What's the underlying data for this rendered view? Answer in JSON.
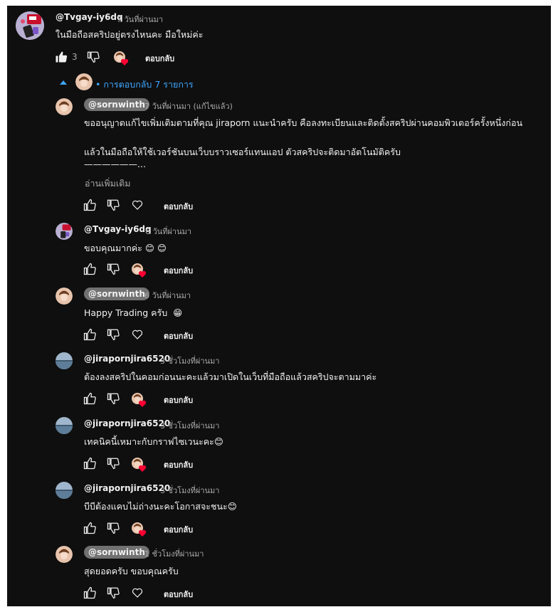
{
  "top_comment": {
    "author": "@Tvgay-iy6dq",
    "time": "7 วันที่ผ่านมา",
    "text": "ในมือถือสคริปอยู่ตรงไหนคะ มือใหม่ค่ะ",
    "likes": "3",
    "reply_label": "ตอบกลับ"
  },
  "replies_toggle": {
    "icon": "chevron-up-icon",
    "label": "• การตอบกลับ 7 รายการ"
  },
  "replies": [
    {
      "author": "@sornwinth",
      "creator_chip": true,
      "time": "7 วันที่ผ่านมา (แก้ไขแล้ว)",
      "lines": [
        "ขออนุญาตแก้ไขเพิ่มเติมตามที่คุณ jiraporn แนะนำครับ คือลงทะเบียนและติดตั้งสคริปผ่านคอมพิวเตอร์ครั้งหนึ่งก่อน",
        "แล้วในมือถือให้ใช้เวอร์ชันบนเว็บบราวเซอร์แทนแอป ตัวสคริปจะติดมาอัตโนมัติครับ",
        "——————..."
      ],
      "read_more": "อ่านเพิ่มเติม",
      "reply_label": "ตอบกลับ",
      "hearted": false
    },
    {
      "author": "@Tvgay-iy6dq",
      "creator_chip": false,
      "time": "6 วันที่ผ่านมา",
      "text": "ขอบคุณมากค่ะ",
      "emoji": "😊 😊",
      "reply_label": "ตอบกลับ",
      "hearted": true
    },
    {
      "author": "@sornwinth",
      "creator_chip": true,
      "time": "6 วันที่ผ่านมา",
      "text": "Happy Trading ครับ",
      "emoji": "😁",
      "reply_label": "ตอบกลับ",
      "hearted": false
    },
    {
      "author": "@jirapornjira6520",
      "creator_chip": false,
      "time": "3 ชั่วโมงที่ผ่านมา",
      "text": "ต้องลงสคริปในคอมก่อนนะคะแล้วมาเปิดในเว็บที่มือถือแล้วสคริปจะตามมาค่ะ",
      "emoji": "",
      "reply_label": "ตอบกลับ",
      "hearted": true
    },
    {
      "author": "@jirapornjira6520",
      "creator_chip": false,
      "time": "3 ชั่วโมงที่ผ่านมา",
      "text": "เทคนิคนี้เหมาะกับกราฟไซเวนะคะ",
      "emoji": "😊",
      "reply_label": "ตอบกลับ",
      "hearted": true
    },
    {
      "author": "@jirapornjira6520",
      "creator_chip": false,
      "time": "3 ชั่วโมงที่ผ่านมา",
      "text": "บีบีต้องแคบไม่ถ่างนะคะโอกาสจะชนะ",
      "emoji": "😊",
      "reply_label": "ตอบกลับ",
      "hearted": true
    },
    {
      "author": "@sornwinth",
      "creator_chip": true,
      "time": "1 ชั่วโมงที่ผ่านมา",
      "text": "สุดยอดครับ ขอบคุณครับ",
      "emoji": "",
      "reply_label": "ตอบกลับ",
      "hearted": false
    }
  ],
  "colors": {
    "background": "#0f0f0f",
    "text": "#f1f1f1",
    "secondary": "#aaaaaa",
    "link_blue": "#3ea6ff",
    "creator_chip": "#717171",
    "heart_red": "#ff0033"
  }
}
